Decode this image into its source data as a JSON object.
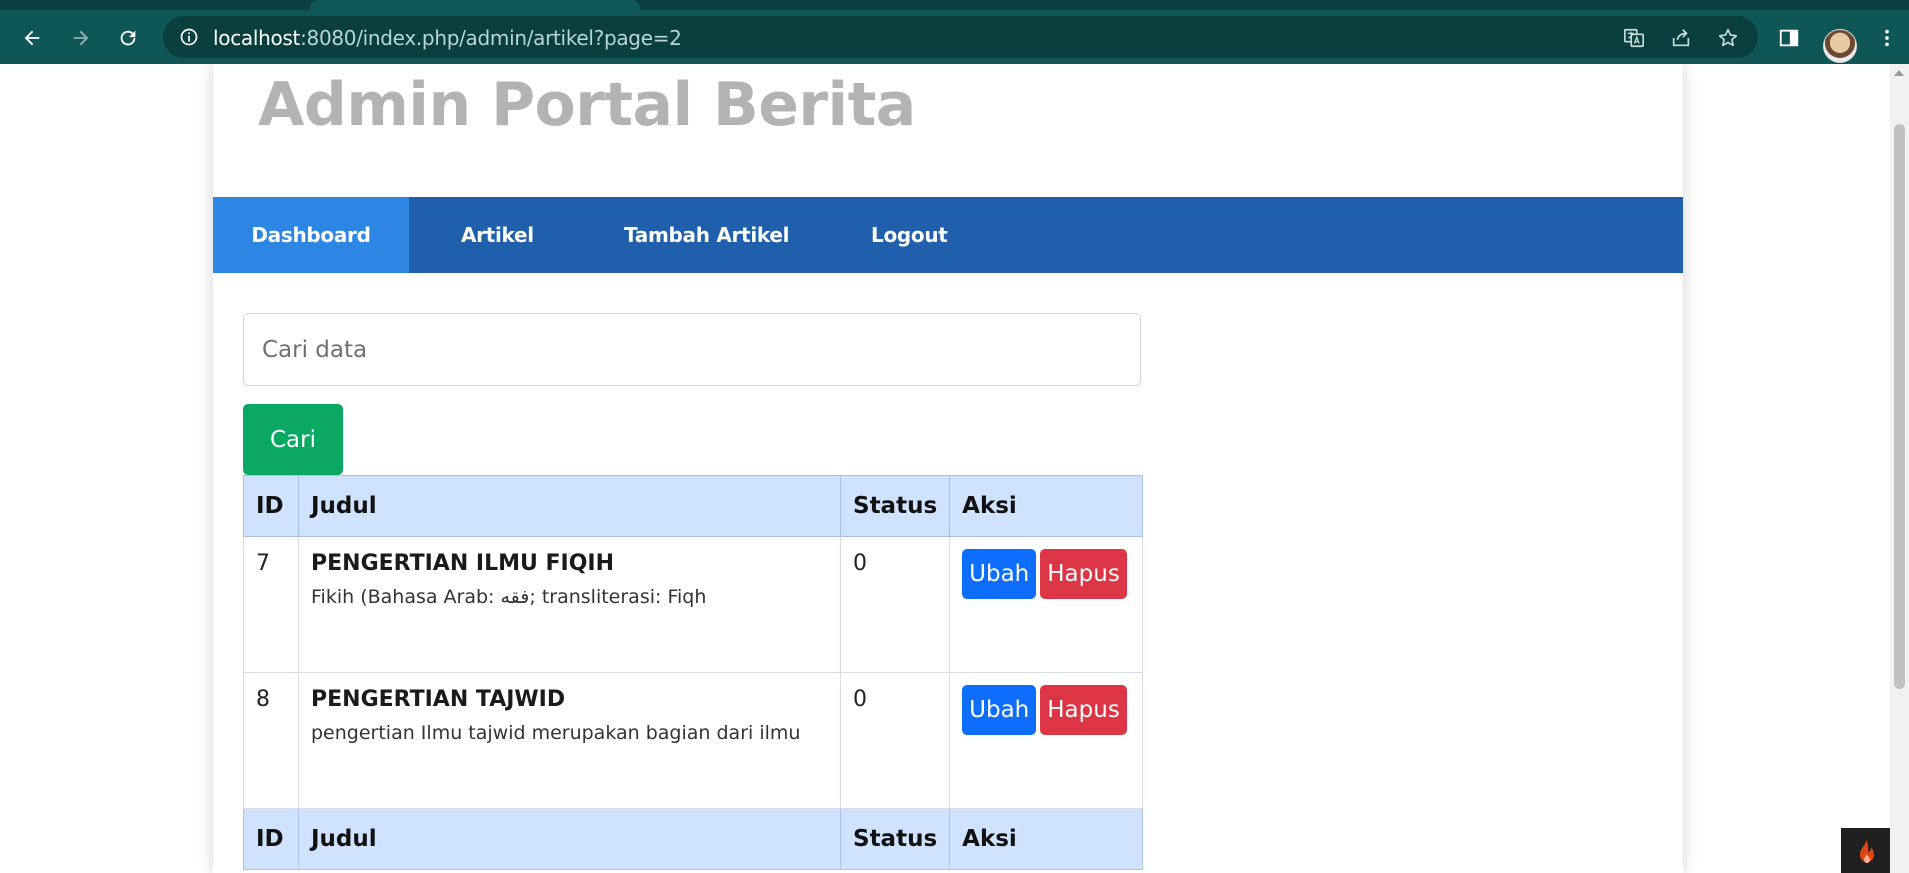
{
  "browser": {
    "url_host": "localhost",
    "url_rest": ":8080/index.php/admin/artikel?page=2",
    "icons": [
      "back-icon",
      "forward-icon",
      "reload-icon",
      "info-icon",
      "translate-icon",
      "share-icon",
      "star-icon",
      "side-panel-icon",
      "avatar",
      "kebab-menu-icon"
    ]
  },
  "site": {
    "title": "Admin Portal Berita"
  },
  "nav": {
    "items": [
      {
        "label": "Dashboard",
        "active": true
      },
      {
        "label": "Artikel",
        "active": false
      },
      {
        "label": "Tambah Artikel",
        "active": false
      },
      {
        "label": "Logout",
        "active": false
      }
    ]
  },
  "search": {
    "placeholder": "Cari data",
    "value": "",
    "button_label": "Cari"
  },
  "table": {
    "columns": [
      "ID",
      "Judul",
      "Status",
      "Aksi"
    ],
    "rows": [
      {
        "id": "7",
        "title": "PENGERTIAN ILMU FIQIH",
        "excerpt": "Fikih (Bahasa Arab: فقه; transliterasi: Fiqh",
        "status": "0",
        "edit_label": "Ubah",
        "delete_label": "Hapus"
      },
      {
        "id": "8",
        "title": "PENGERTIAN TAJWID",
        "excerpt": "pengertian Ilmu tajwid merupakan bagian dari ilmu",
        "status": "0",
        "edit_label": "Ubah",
        "delete_label": "Hapus"
      }
    ],
    "footer_columns": [
      "ID",
      "Judul",
      "Status",
      "Aksi"
    ]
  },
  "colors": {
    "browser_toolbar": "#0e5756",
    "nav_bg": "#1f5fab",
    "nav_active": "#2d86e4",
    "search_button": "#0ba863",
    "header_row": "#cfe2ff",
    "edit_button": "#0d6efd",
    "delete_button": "#dc3545"
  }
}
